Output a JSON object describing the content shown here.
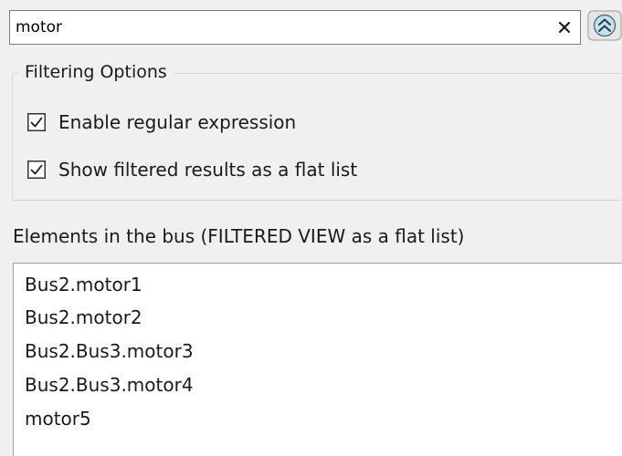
{
  "search": {
    "value": "motor",
    "clear_icon": "close-icon",
    "collapse_icon": "double-chevron-up-icon"
  },
  "filtering": {
    "title": "Filtering Options",
    "options": [
      {
        "label": "Enable regular expression",
        "checked": true
      },
      {
        "label": "Show filtered results as a flat list",
        "checked": true
      }
    ]
  },
  "elements": {
    "heading": "Elements in the bus (FILTERED VIEW as a flat list)",
    "items": [
      "Bus2.motor1",
      "Bus2.motor2",
      "Bus2.Bus3.motor3",
      "Bus2.Bus3.motor4",
      "motor5"
    ]
  },
  "colors": {
    "window_background": "#f0f0f0",
    "collapse_button_fill": "#bfe3f2",
    "collapse_button_border": "#5a6e78"
  }
}
